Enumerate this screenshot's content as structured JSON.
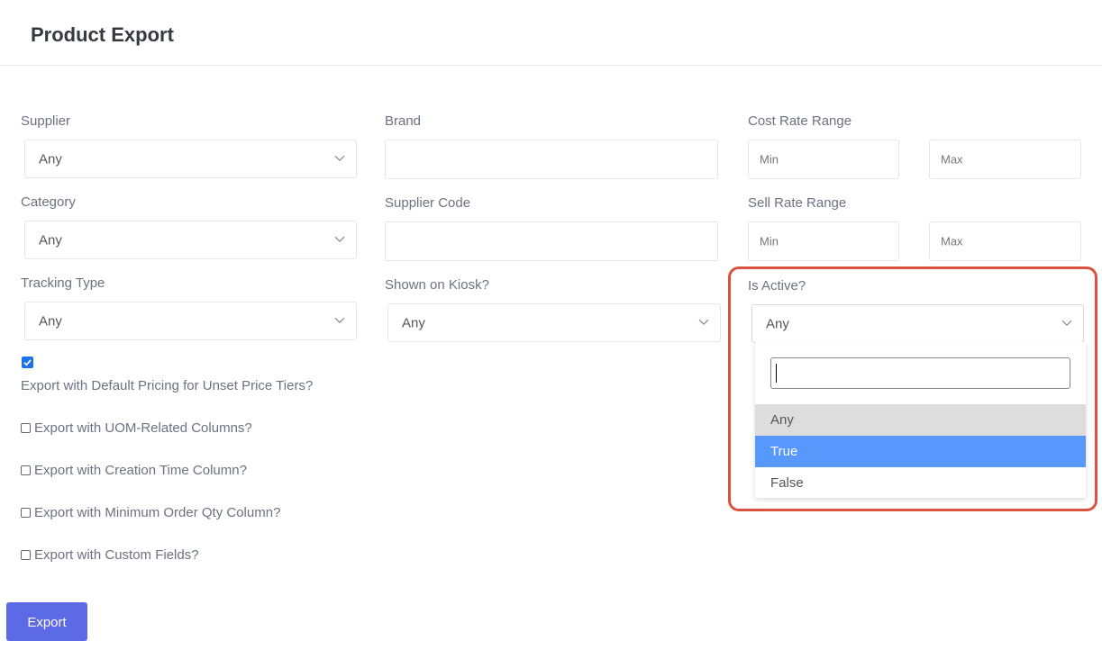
{
  "page": {
    "title": "Product Export"
  },
  "filters": {
    "supplier": {
      "label": "Supplier",
      "value": "Any"
    },
    "brand": {
      "label": "Brand",
      "value": ""
    },
    "cost_rate": {
      "label": "Cost Rate Range",
      "min_placeholder": "Min",
      "max_placeholder": "Max"
    },
    "category": {
      "label": "Category",
      "value": "Any"
    },
    "supplier_code": {
      "label": "Supplier Code",
      "value": ""
    },
    "sell_rate": {
      "label": "Sell Rate Range",
      "min_placeholder": "Min",
      "max_placeholder": "Max"
    },
    "tracking_type": {
      "label": "Tracking Type",
      "value": "Any"
    },
    "shown_on_kiosk": {
      "label": "Shown on Kiosk?",
      "value": "Any"
    },
    "is_active": {
      "label": "Is Active?",
      "value": "Any",
      "search_value": "",
      "options": [
        "Any",
        "True",
        "False"
      ],
      "hovered_option": "Any",
      "highlighted_option": "True"
    }
  },
  "checkboxes": [
    {
      "label": "Export with Default Pricing for Unset Price Tiers?",
      "checked": true
    },
    {
      "label": "Export with UOM-Related Columns?",
      "checked": false
    },
    {
      "label": "Export with Creation Time Column?",
      "checked": false
    },
    {
      "label": "Export with Minimum Order Qty Column?",
      "checked": false
    },
    {
      "label": "Export with Custom Fields?",
      "checked": false
    }
  ],
  "actions": {
    "export_label": "Export"
  },
  "colors": {
    "accent": "#5d6ae6",
    "checkbox_checked": "#1a73e8",
    "option_highlight": "#5897fb",
    "annotation_outline": "#d9533f"
  }
}
